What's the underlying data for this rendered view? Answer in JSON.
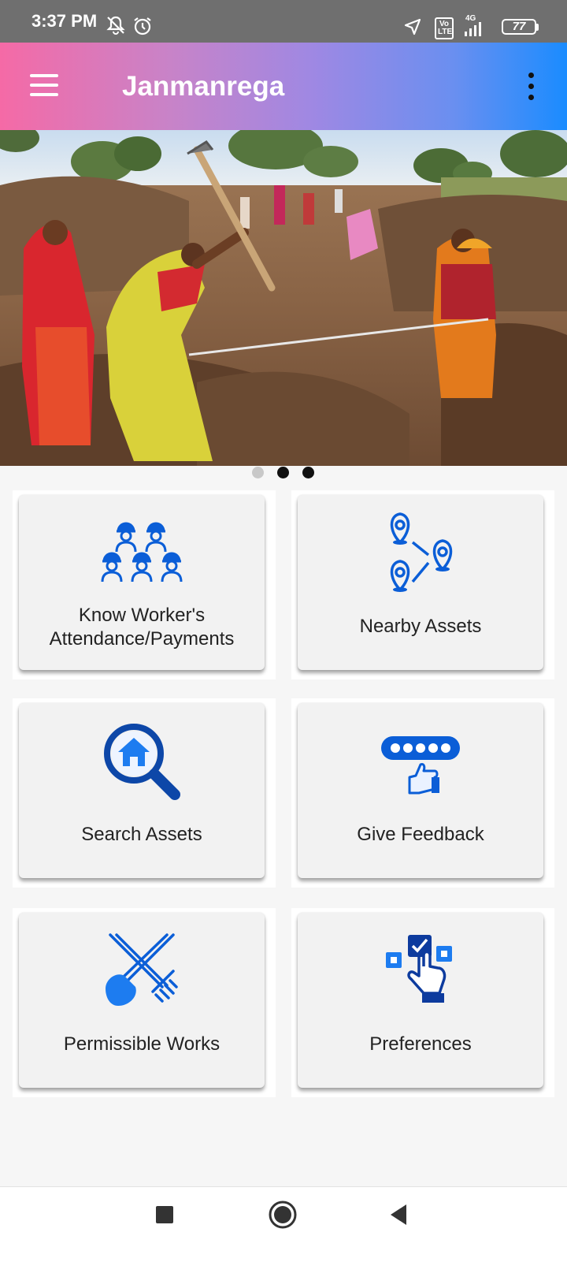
{
  "status_bar": {
    "time": "3:37 PM",
    "lte_label": "Vo LTE",
    "network_label": "4G",
    "battery": "77",
    "icons": [
      "mute-notifications-icon",
      "alarm-icon",
      "location-icon",
      "volte-icon",
      "signal-icon",
      "battery-icon"
    ]
  },
  "app_bar": {
    "title": "Janmanrega",
    "gradient": [
      "#f56aa6",
      "#1a8cff"
    ],
    "icons": [
      "hamburger-menu-icon",
      "overflow-menu-icon"
    ]
  },
  "carousel": {
    "slide_count": 3,
    "active_slide": 2,
    "image_subject": "rural-workers-digging-photo"
  },
  "tiles": [
    {
      "label_line1": "Know Worker's",
      "label_line2": "Attendance/Payments",
      "icon": "workers-group-icon"
    },
    {
      "label": "Nearby Assets",
      "icon": "map-pins-icon"
    },
    {
      "label": "Search Assets",
      "icon": "search-house-icon"
    },
    {
      "label": "Give Feedback",
      "icon": "rating-thumbs-up-icon"
    },
    {
      "label": "Permissible Works",
      "icon": "shovel-rake-icon"
    },
    {
      "label": "Preferences",
      "icon": "hand-select-icon"
    }
  ],
  "theme": {
    "icon_color": "#0b5ed7",
    "icon_dark": "#0d3b9e",
    "card_bg": "#f2f2f2"
  },
  "nav_bar": {
    "icons": [
      "recents-square-icon",
      "home-circle-icon",
      "back-triangle-icon"
    ]
  }
}
